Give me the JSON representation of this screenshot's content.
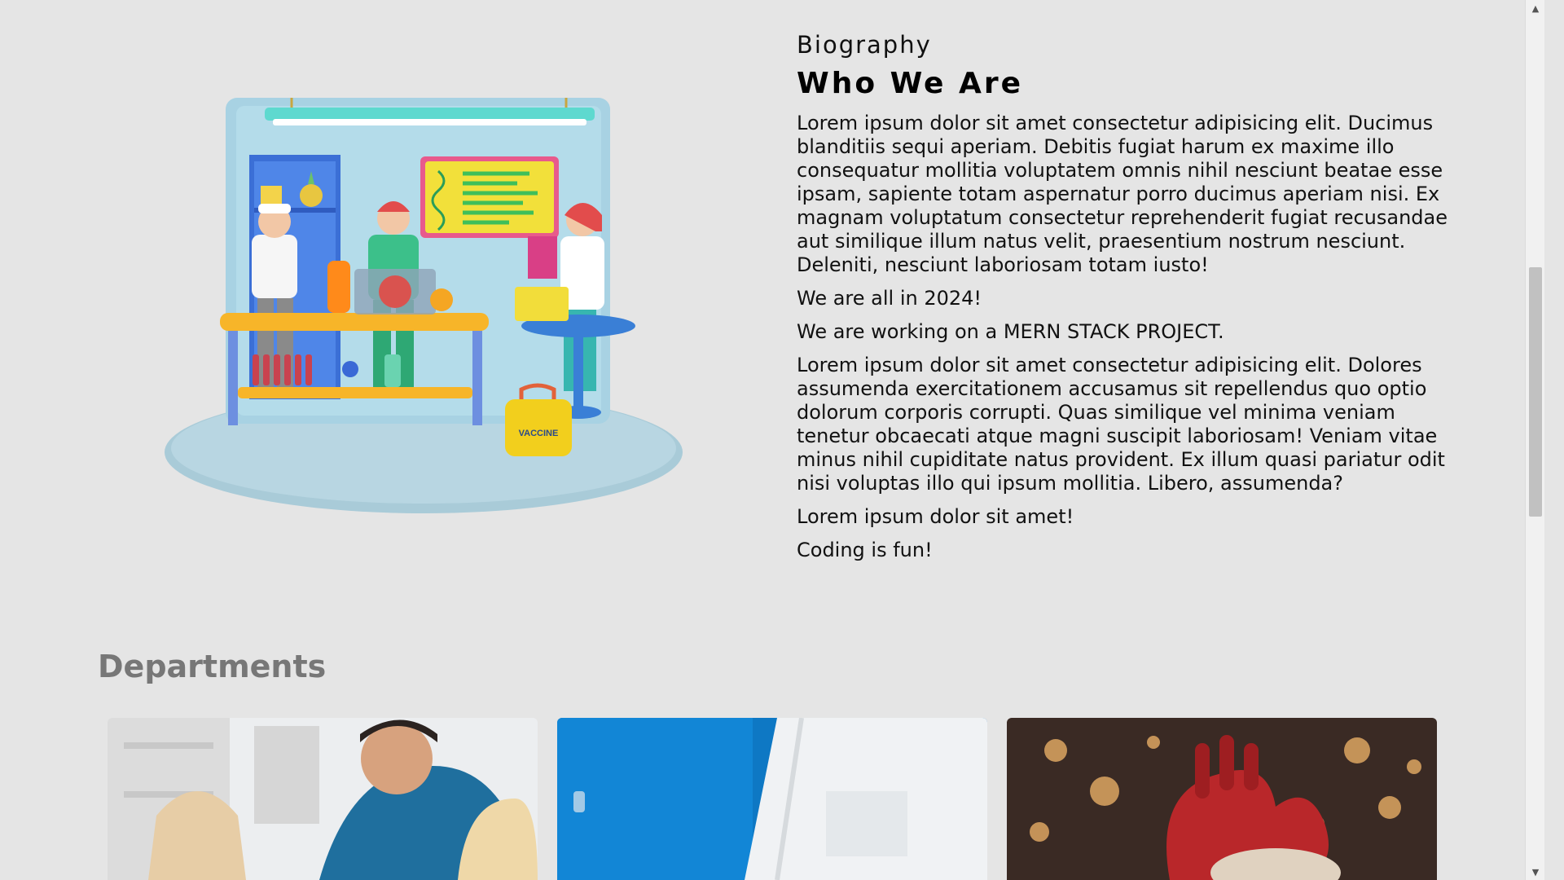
{
  "biography": {
    "eyebrow": "Biography",
    "heading": "Who We Are",
    "paragraphs": [
      "Lorem ipsum dolor sit amet consectetur adipisicing elit. Ducimus blanditiis sequi aperiam. Debitis fugiat harum ex maxime illo consequatur mollitia voluptatem omnis nihil nesciunt beatae esse ipsam, sapiente totam aspernatur porro ducimus aperiam nisi. Ex magnam voluptatum consectetur reprehenderit fugiat recusandae aut similique illum natus velit, praesentium nostrum nesciunt. Deleniti, nesciunt laboriosam totam iusto!",
      "We are all in 2024!",
      "We are working on a MERN STACK PROJECT.",
      "Lorem ipsum dolor sit amet consectetur adipisicing elit. Dolores assumenda exercitationem accusamus sit repellendus quo optio dolorum corporis corrupti. Quas similique vel minima veniam tenetur obcaecati atque magni suscipit laboriosam! Veniam vitae minus nihil cupiditate natus provident. Ex illum quasi pariatur odit nisi voluptas illo qui ipsum mollitia. Libero, assumenda?",
      "Lorem ipsum dolor sit amet!",
      "Coding is fun!"
    ],
    "illustration_label": "VACCINE"
  },
  "departments": {
    "title": "Departments"
  },
  "colors": {
    "background": "#e5e5e5",
    "department_title": "#777777",
    "scroll_thumb": "#c1c1c1"
  },
  "icons": {
    "scroll_up": "triangle-up",
    "scroll_down": "triangle-down"
  }
}
